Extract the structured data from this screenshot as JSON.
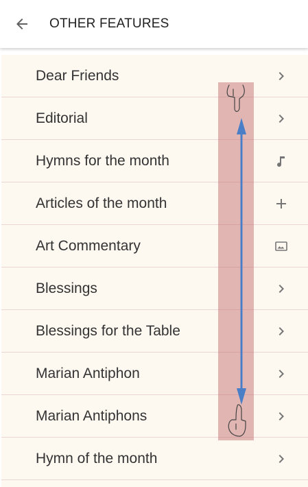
{
  "header": {
    "title": "OTHER FEATURES",
    "back_icon": "arrow-left-icon"
  },
  "list": {
    "items": [
      {
        "label": "Dear Friends",
        "icon": "chevron-right-icon"
      },
      {
        "label": "Editorial",
        "icon": "chevron-right-icon"
      },
      {
        "label": "Hymns for the month",
        "icon": "music-note-icon"
      },
      {
        "label": "Articles of the month",
        "icon": "plus-icon"
      },
      {
        "label": "Art Commentary",
        "icon": "image-icon"
      },
      {
        "label": "Blessings",
        "icon": "chevron-right-icon"
      },
      {
        "label": "Blessings for the Table",
        "icon": "chevron-right-icon"
      },
      {
        "label": "Marian Antiphon",
        "icon": "chevron-right-icon"
      },
      {
        "label": "Marian Antiphons",
        "icon": "chevron-right-icon"
      },
      {
        "label": "Hymn of the month",
        "icon": "chevron-right-icon"
      }
    ]
  },
  "gesture": {
    "type": "vertical-swipe",
    "icons": [
      "hand-pointer-down-icon",
      "double-arrow-vertical-icon",
      "hand-pointer-up-icon"
    ]
  },
  "colors": {
    "list_background": "#fdf8f0",
    "divider": "#ecd5d5",
    "gesture_overlay": "#c48a8a",
    "gesture_arrow": "#4a7fc8"
  }
}
